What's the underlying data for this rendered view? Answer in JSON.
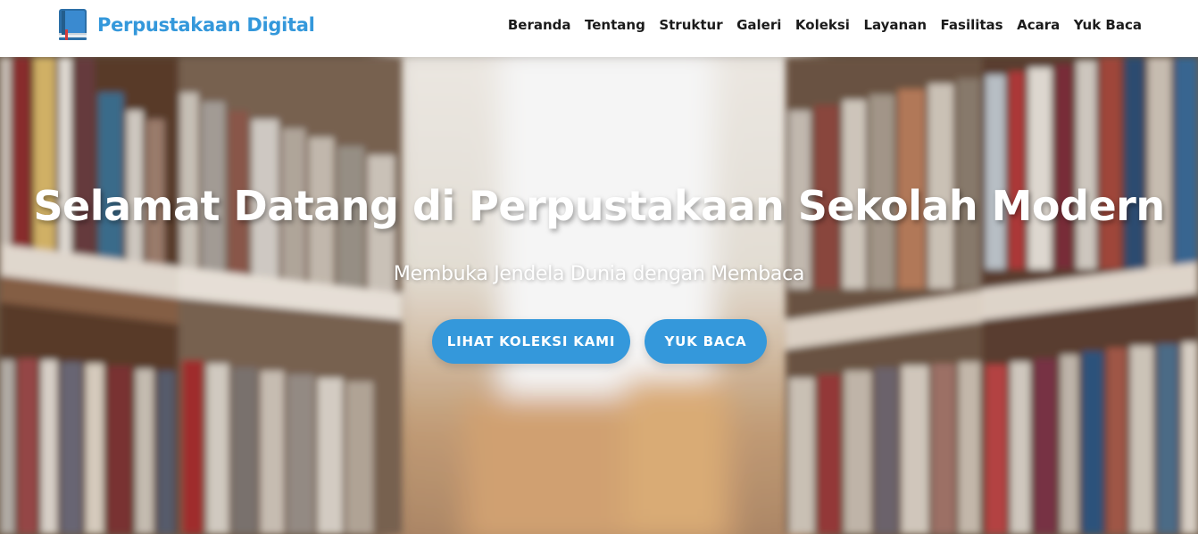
{
  "brand": {
    "name": "Perpustakaan Digital",
    "icon": "book-icon",
    "accent": "#3498db"
  },
  "nav": {
    "links": [
      {
        "label": "Beranda"
      },
      {
        "label": "Tentang"
      },
      {
        "label": "Struktur"
      },
      {
        "label": "Galeri"
      },
      {
        "label": "Koleksi"
      },
      {
        "label": "Layanan"
      },
      {
        "label": "Fasilitas"
      },
      {
        "label": "Acara"
      },
      {
        "label": "Yuk Baca"
      }
    ]
  },
  "hero": {
    "title": "Selamat Datang di Perpustakaan Sekolah Modern",
    "subtitle": "Membuka Jendela Dunia dengan Membaca",
    "buttons": {
      "collection": "LIHAT KOLEKSI KAMI",
      "read": "YUK BACA"
    },
    "background": "blurred-library-bookshelves-photo"
  }
}
